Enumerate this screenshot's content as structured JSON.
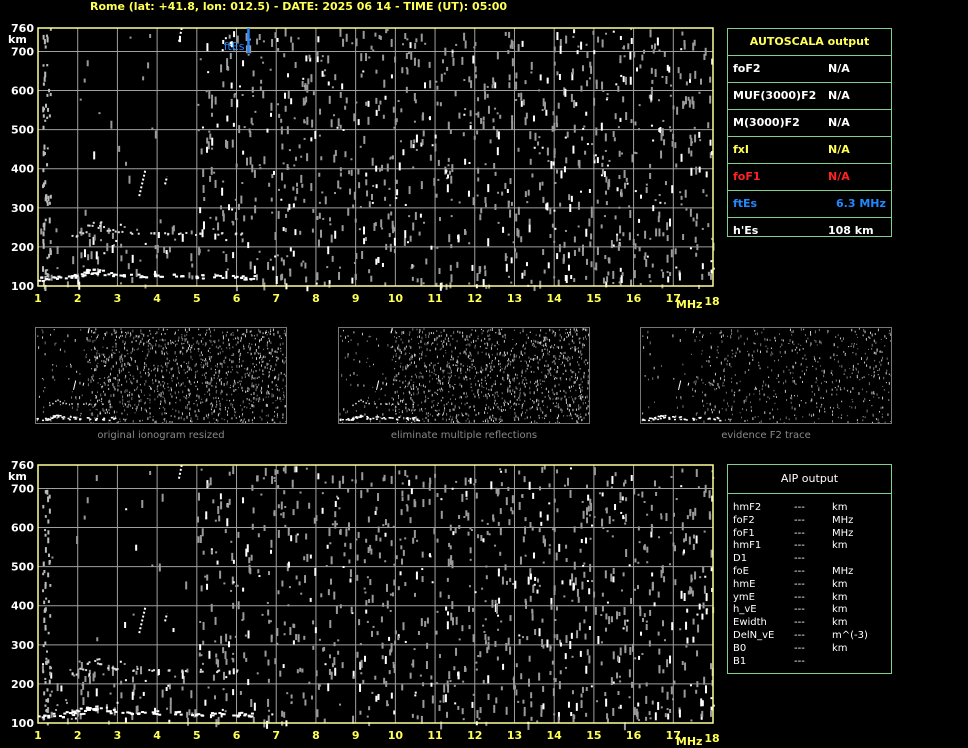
{
  "header": "Rome (lat: +41.8, lon: 012.5) - DATE: 2025 06 14 - TIME (UT): 05:00",
  "colors": {
    "grid": "#a0a0a0",
    "frame": "#ffff99",
    "axis_text": "#ffff55",
    "trace": "#ffffff",
    "noise": "#9a9a9a",
    "es_marker": "#2288ff",
    "panel_border": "#7fd08a"
  },
  "chart_data": [
    {
      "type": "scatter",
      "name": "ionogram-top",
      "xlabel": "MHz",
      "ylabel": "km",
      "xlim": [
        1,
        18
      ],
      "ylim": [
        100,
        760
      ],
      "x_ticks": [
        "1",
        "2",
        "3",
        "4",
        "5",
        "6",
        "7",
        "8",
        "9",
        "10",
        "11",
        "12",
        "13",
        "14",
        "15",
        "16",
        "17",
        "18"
      ],
      "y_ticks": [
        "100",
        "200",
        "300",
        "400",
        "500",
        "600",
        "700",
        "760"
      ],
      "grid": true,
      "annotation": {
        "label": "ftEs",
        "x": 6.3,
        "color": "#2288ff"
      },
      "traces": {
        "es_layer": [
          [
            1.1,
            118
          ],
          [
            1.5,
            120
          ],
          [
            1.8,
            124
          ],
          [
            2.0,
            128
          ],
          [
            2.2,
            134
          ],
          [
            2.35,
            140
          ],
          [
            2.5,
            136
          ],
          [
            2.8,
            130
          ],
          [
            3.2,
            128
          ],
          [
            3.6,
            127
          ],
          [
            4.0,
            126
          ],
          [
            4.5,
            125
          ],
          [
            5.0,
            124
          ],
          [
            5.5,
            123
          ],
          [
            6.0,
            122
          ],
          [
            6.3,
            121
          ]
        ],
        "es_multiple": [
          [
            1.9,
            228
          ],
          [
            2.1,
            240
          ],
          [
            2.3,
            256
          ],
          [
            2.45,
            264
          ],
          [
            2.6,
            254
          ],
          [
            2.8,
            244
          ],
          [
            3.0,
            240
          ],
          [
            3.4,
            238
          ],
          [
            3.8,
            237
          ],
          [
            4.2,
            236
          ],
          [
            4.6,
            236
          ],
          [
            5.0,
            236
          ],
          [
            5.5,
            235
          ],
          [
            6.0,
            235
          ]
        ],
        "streaks": [
          [
            [
              3.55,
              330
            ],
            [
              3.7,
              395
            ]
          ],
          [
            [
              4.2,
              360
            ],
            [
              4.25,
              380
            ]
          ],
          [
            [
              4.55,
              725
            ],
            [
              4.62,
              760
            ]
          ]
        ]
      }
    },
    {
      "type": "scatter",
      "name": "ionogram-bottom",
      "xlabel": "MHz",
      "ylabel": "km",
      "xlim": [
        1,
        18
      ],
      "ylim": [
        100,
        760
      ],
      "x_ticks": [
        "1",
        "2",
        "3",
        "4",
        "5",
        "6",
        "7",
        "8",
        "9",
        "10",
        "11",
        "12",
        "13",
        "14",
        "15",
        "16",
        "17",
        "18"
      ],
      "y_ticks": [
        "100",
        "200",
        "300",
        "400",
        "500",
        "600",
        "700",
        "760"
      ],
      "grid": true
    }
  ],
  "autoscala": {
    "title": "AUTOSCALA output",
    "rows": [
      {
        "label": "foF2",
        "value": "N/A",
        "color": "#ffffff"
      },
      {
        "label": "MUF(3000)F2",
        "value": "N/A",
        "color": "#ffffff"
      },
      {
        "label": "M(3000)F2",
        "value": "N/A",
        "color": "#ffffff"
      },
      {
        "label": "fxI",
        "value": "N/A",
        "color": "#ffff55"
      },
      {
        "label": "foF1",
        "value": "N/A",
        "color": "#ff2222"
      },
      {
        "label": "ftEs",
        "value": "6.3  MHz",
        "color": "#2288ff"
      },
      {
        "label": "h'Es",
        "value": "108     km",
        "color": "#ffffff"
      }
    ]
  },
  "aip": {
    "title": "AIP output",
    "rows": [
      {
        "name": "hmF2",
        "value": "---",
        "unit": "km"
      },
      {
        "name": "foF2",
        "value": "---",
        "unit": "MHz"
      },
      {
        "name": "foF1",
        "value": "---",
        "unit": "MHz"
      },
      {
        "name": "hmF1",
        "value": "---",
        "unit": "km"
      },
      {
        "name": "D1",
        "value": "---",
        "unit": ""
      },
      {
        "name": "foE",
        "value": "---",
        "unit": "MHz"
      },
      {
        "name": "hmE",
        "value": "---",
        "unit": "km"
      },
      {
        "name": "ymE",
        "value": "---",
        "unit": "km"
      },
      {
        "name": "h_vE",
        "value": "---",
        "unit": "km"
      },
      {
        "name": "Ewidth",
        "value": "---",
        "unit": "km"
      },
      {
        "name": "DelN_vE",
        "value": "---",
        "unit": "m^(-3)"
      },
      {
        "name": "B0",
        "value": "---",
        "unit": "km"
      },
      {
        "name": "B1",
        "value": "---",
        "unit": ""
      }
    ]
  },
  "thumbnails": [
    {
      "caption": "original ionogram resized",
      "variant": "original"
    },
    {
      "caption": "eliminate multiple reflections",
      "variant": "eliminate"
    },
    {
      "caption": "evidence F2 trace",
      "variant": "evidence"
    }
  ]
}
